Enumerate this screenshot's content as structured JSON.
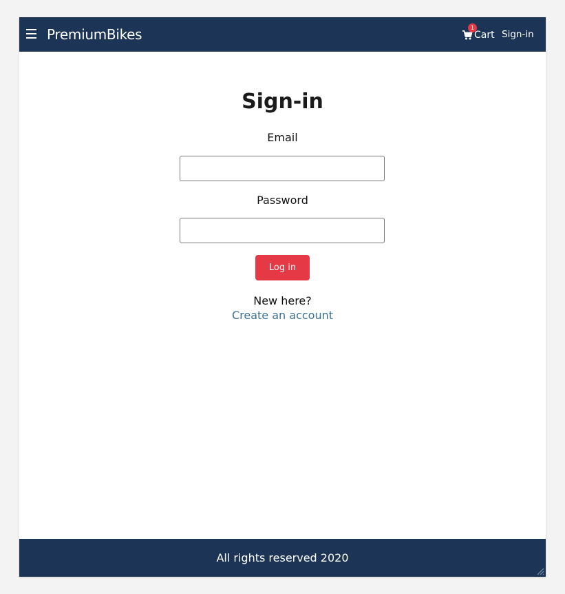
{
  "header": {
    "brand": "PremiumBikes",
    "cart_label": "Cart",
    "cart_count": "1",
    "signin_label": "Sign-in"
  },
  "form": {
    "title": "Sign-in",
    "email_label": "Email",
    "email_value": "",
    "password_label": "Password",
    "password_value": "",
    "login_label": "Log in",
    "new_here": "New here?",
    "create_account": "Create an account"
  },
  "footer": {
    "text": "All rights reserved 2020"
  },
  "colors": {
    "header_bg": "#1c3557",
    "accent": "#e63946",
    "link": "#3b7194"
  },
  "icons": [
    "menu-icon",
    "cart-icon",
    "resize-grip-icon"
  ]
}
